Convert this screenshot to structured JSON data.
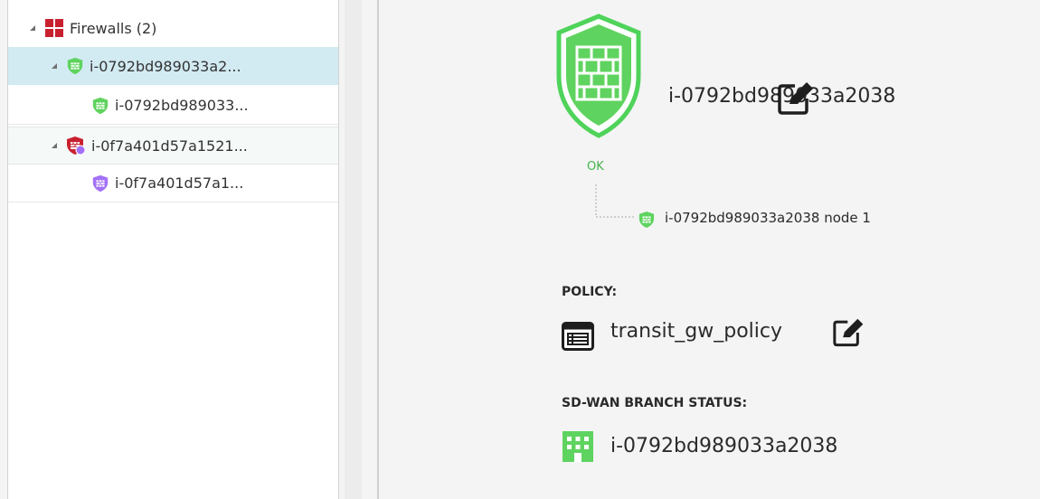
{
  "tree": {
    "root": {
      "label": "Firewalls (2)"
    },
    "items": [
      {
        "label": "i-0792bd989033a2...",
        "status": "ok",
        "level": 1
      },
      {
        "label": "i-0792bd989033...",
        "status": "ok",
        "level": 2
      },
      {
        "label": "i-0f7a401d57a1521...",
        "status": "error",
        "level": 1
      },
      {
        "label": "i-0f7a401d57a1...",
        "status": "unknown",
        "level": 2
      }
    ]
  },
  "detail": {
    "firewall_name": "i-0792bd989033a2038",
    "status_text": "OK",
    "node_label": "i-0792bd989033a2038 node 1",
    "policy": {
      "label": "POLICY:",
      "name": "transit_gw_policy"
    },
    "branch": {
      "label": "SD-WAN BRANCH STATUS:",
      "name": "i-0792bd989033a2038"
    }
  },
  "colors": {
    "ok_green": "#5fd35f",
    "error_red": "#c9202f",
    "unknown_purple": "#a371f7",
    "selection": "#d2eaf2"
  }
}
